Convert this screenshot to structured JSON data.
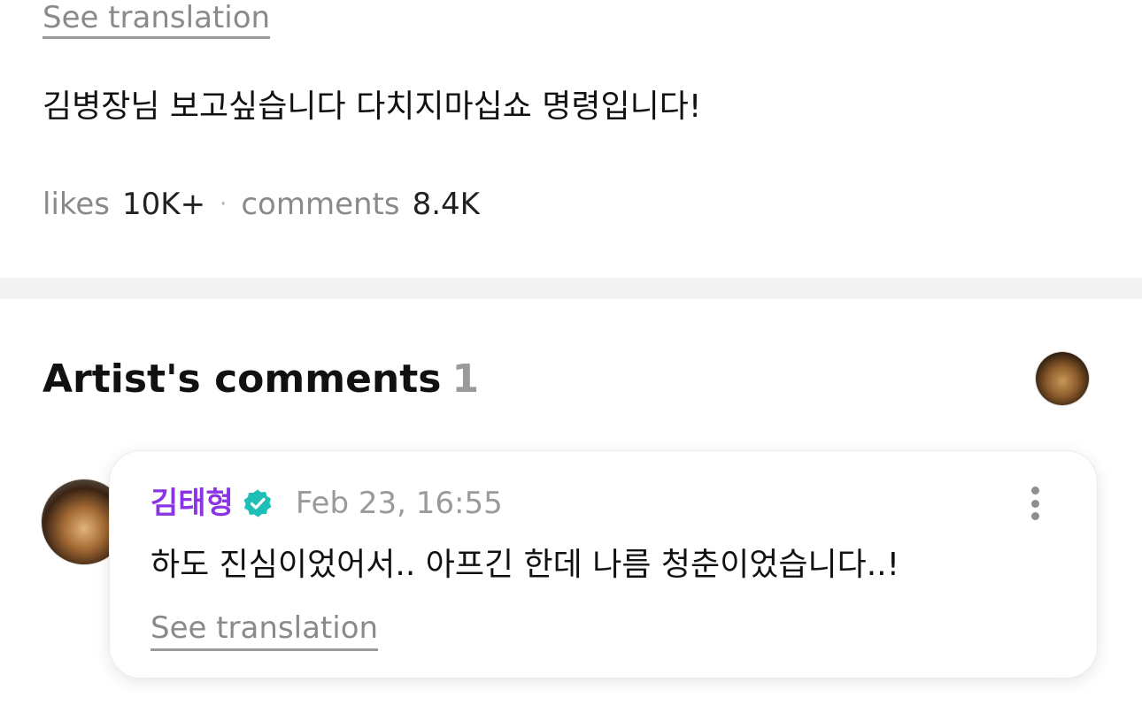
{
  "post": {
    "see_translation": "See translation",
    "text": "김병장님 보고싶습니다 다치지마십쇼 명령입니다!",
    "likes_label": "likes",
    "likes_value": "10K+",
    "separator": "·",
    "comments_label": "comments",
    "comments_value": "8.4K"
  },
  "artist_comments": {
    "title": "Artist's comments",
    "count": "1",
    "comment": {
      "author": "김태형",
      "verified_icon": "verified-badge-icon",
      "timestamp": "Feb 23, 16:55",
      "text": "하도 진심이었어서.. 아프긴 한데 나름 청춘이었습니다..!",
      "see_translation": "See translation",
      "more_icon": "more-vertical-icon"
    }
  },
  "colors": {
    "author": "#8a34e6",
    "verified": "#1fbfb8",
    "muted": "#8a8a8a",
    "divider": "#f3f3f3"
  }
}
